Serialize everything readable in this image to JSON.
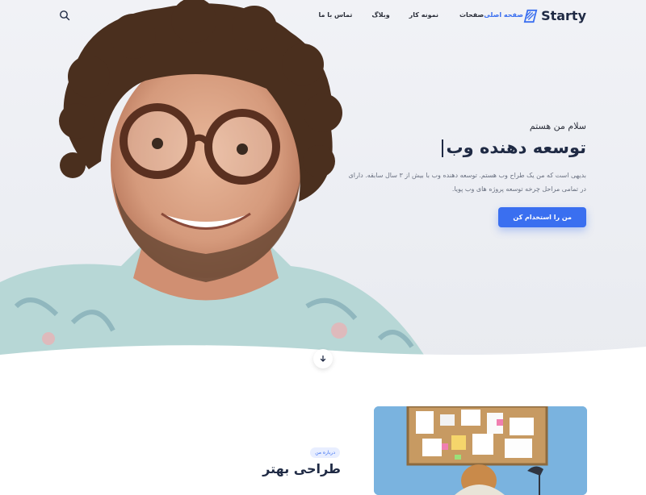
{
  "brand": {
    "name": "Starty"
  },
  "nav": {
    "items": [
      {
        "label": "صفحه اصلی",
        "active": true
      },
      {
        "label": "صفحات",
        "active": false
      },
      {
        "label": "نمونه کار",
        "active": false
      },
      {
        "label": "وبلاگ",
        "active": false
      },
      {
        "label": "تماس با ما",
        "active": false
      }
    ],
    "search_icon": "search-icon"
  },
  "hero": {
    "eyebrow": "سلام من هستم",
    "headline": "توسعه دهنده وب",
    "description_line1": "بدیهی است که من یک طراح وب هستم. توسعه دهنده وب با بیش از ۳ سال سابقه. دارای",
    "description_line2": "در تمامی مراحل چرخه توسعه پروژه های وب پویا.",
    "cta_label": "من را استخدام کن",
    "scroll_icon": "arrow-down-icon"
  },
  "about": {
    "badge": "درباره من",
    "title": "طراحی بهتر"
  },
  "colors": {
    "accent": "#3a6ff0",
    "text_dark": "#1f2a44",
    "text_muted": "#6b7282",
    "hero_bg": "#eceef3"
  }
}
